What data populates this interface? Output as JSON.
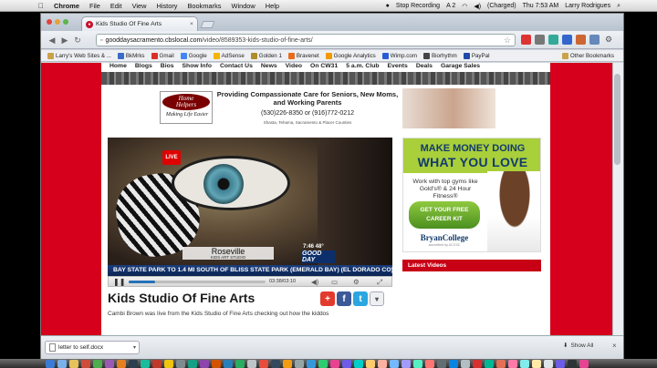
{
  "menubar": {
    "apple": "",
    "app": "Chrome",
    "items": [
      "File",
      "Edit",
      "View",
      "History",
      "Bookmarks",
      "Window",
      "Help"
    ],
    "status_recording": "Stop Recording",
    "status_misc": "A 2",
    "battery": "(Charged)",
    "clock": "Thu 7:53 AM",
    "user": "Larry Rodrigues"
  },
  "browser": {
    "tab_title": "Kids Studio Of Fine Arts",
    "tab_close": "×",
    "url_domain": "gooddaysacramento.cbslocal.com",
    "url_path": "/video/8589353-kids-studio-of-fine-arts/",
    "bookmarks": [
      {
        "label": "Larry's Web Sites & ...",
        "color": "#c9a24a"
      },
      {
        "label": "BkMrks",
        "color": "#3a6bc7"
      },
      {
        "label": "Gmail",
        "color": "#d93025"
      },
      {
        "label": "Google",
        "color": "#4285f4"
      },
      {
        "label": "AdSense",
        "color": "#f4b400"
      },
      {
        "label": "Golden 1",
        "color": "#b08c2a"
      },
      {
        "label": "Bravenet",
        "color": "#e86c1d"
      },
      {
        "label": "Google Analytics",
        "color": "#f29900"
      },
      {
        "label": "Wimp.com",
        "color": "#2a5bd7"
      },
      {
        "label": "Biorhythm",
        "color": "#444"
      },
      {
        "label": "PayPal",
        "color": "#1f4aa8"
      }
    ],
    "other_bookmarks": "Other Bookmarks"
  },
  "site": {
    "nav": [
      "Home",
      "Blogs",
      "Bios",
      "Show Info",
      "Contact Us",
      "News",
      "Video",
      "On CW31",
      "5 a.m. Club",
      "Events",
      "Deals",
      "Garage Sales"
    ],
    "ad1": {
      "logo_line1": "Home",
      "logo_line2": "Helpers",
      "logo_tagline": "Making Life Easier",
      "headline": "Providing Compassionate Care for Seniors, New Moms, and Working Parents",
      "phone": "(530)226-8350 or (916)772-0212",
      "areas": "Shasta, Tehama, Sacramento & Placer Counties"
    },
    "video": {
      "live": "LIVE",
      "location": "Roseville",
      "location_sub": "KIDS ART STUDIO",
      "time_bug": "7:46   48°",
      "logo": "GOOD DAY",
      "ticker": "BAY STATE PARK TO 1.4 MI SOUTH OF BLISS STATE PARK  (EMERALD BAY)  (EL DORADO CO)",
      "progress": 0.19,
      "time": "03:38/03:10"
    },
    "title": "Kids Studio Of Fine Arts",
    "description": "Cambi Brown was live from the Kids Studio of Fine Arts checking out how the kiddos",
    "ad2": {
      "line1": "MAKE MONEY DOING",
      "line2": "WHAT YOU LOVE",
      "sub": "Work with top gyms like Gold's® & 24 Hour Fitness®",
      "button": "GET YOUR FREE CAREER KIT",
      "brand": "BryanCollege",
      "brand_small": "accredited by ACCSC"
    },
    "latest_videos": "Latest Videos"
  },
  "downloads": {
    "file": "letter to self.docx",
    "show_all": "Show All",
    "close": "×"
  }
}
